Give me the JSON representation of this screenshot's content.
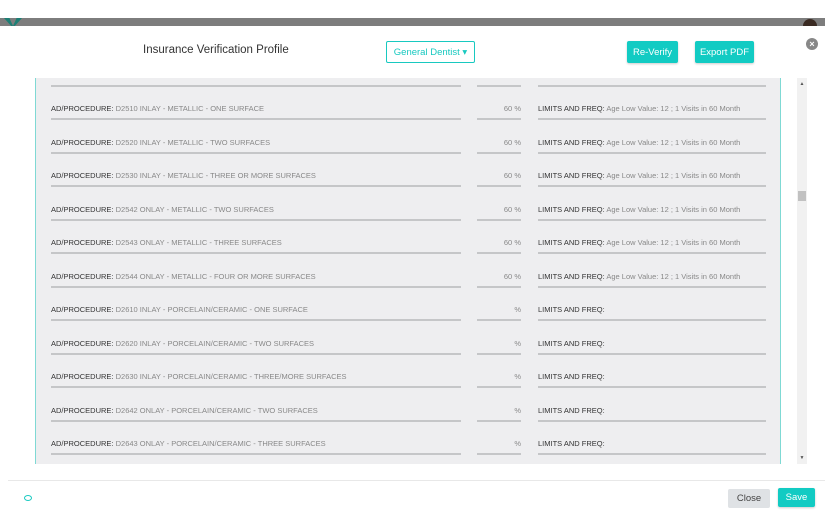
{
  "header": {
    "title": "Insurance Verification Profile",
    "dropdown": "General Dentist ▾",
    "reverify": "Re-Verify",
    "export": "Export PDF",
    "close_icon": "close-circle-icon"
  },
  "labels": {
    "procedure": "AD/PROCEDURE:",
    "limits": "LIMITS AND FREQ:"
  },
  "rows": [
    {
      "proc": "D2510 INLAY - METALLIC - ONE SURFACE",
      "pct": "60 %",
      "limits": "Age Low Value: 12 ; 1 Visits in 60 Month"
    },
    {
      "proc": "D2520 INLAY - METALLIC - TWO SURFACES",
      "pct": "60 %",
      "limits": "Age Low Value: 12 ; 1 Visits in 60 Month"
    },
    {
      "proc": "D2530 INLAY - METALLIC - THREE OR MORE SURFACES",
      "pct": "60 %",
      "limits": "Age Low Value: 12 ; 1 Visits in 60 Month"
    },
    {
      "proc": "D2542 ONLAY - METALLIC - TWO SURFACES",
      "pct": "60 %",
      "limits": "Age Low Value: 12 ; 1 Visits in 60 Month"
    },
    {
      "proc": "D2543 ONLAY - METALLIC - THREE SURFACES",
      "pct": "60 %",
      "limits": "Age Low Value: 12 ; 1 Visits in 60 Month"
    },
    {
      "proc": "D2544 ONLAY - METALLIC - FOUR OR MORE SURFACES",
      "pct": "60 %",
      "limits": "Age Low Value: 12 ; 1 Visits in 60 Month"
    },
    {
      "proc": "D2610 INLAY - PORCELAIN/CERAMIC - ONE SURFACE",
      "pct": "%",
      "limits": ""
    },
    {
      "proc": "D2620 INLAY - PORCELAIN/CERAMIC - TWO SURFACES",
      "pct": "%",
      "limits": ""
    },
    {
      "proc": "D2630 INLAY - PORCELAIN/CERAMIC - THREE/MORE SURFACES",
      "pct": "%",
      "limits": ""
    },
    {
      "proc": "D2642 ONLAY - PORCELAIN/CERAMIC - TWO SURFACES",
      "pct": "%",
      "limits": ""
    },
    {
      "proc": "D2643 ONLAY - PORCELAIN/CERAMIC - THREE SURFACES",
      "pct": "%",
      "limits": ""
    }
  ],
  "footer": {
    "close": "Close",
    "save": "Save",
    "eye_icon": "eye-icon"
  }
}
